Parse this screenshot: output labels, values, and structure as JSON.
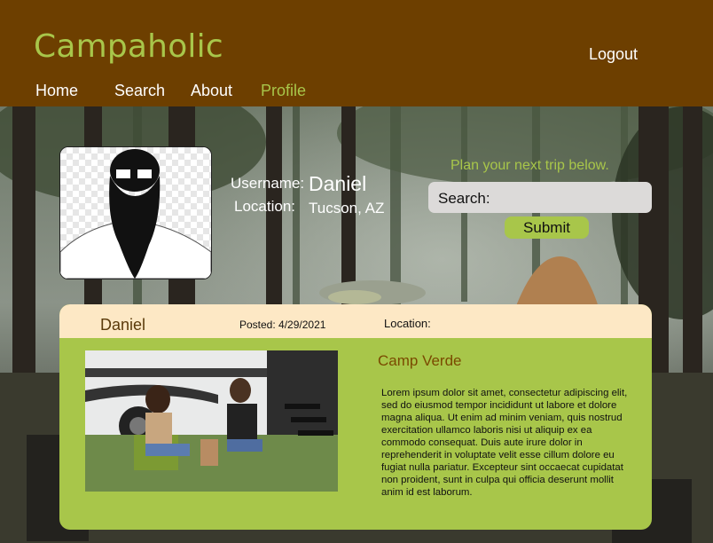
{
  "app": {
    "brand": "Campaholic",
    "logout_label": "Logout"
  },
  "nav": {
    "items": [
      {
        "label": "Home"
      },
      {
        "label": "Search"
      },
      {
        "label": "About"
      },
      {
        "label": "Profile",
        "active": true
      }
    ]
  },
  "profile": {
    "username_label": "Username:",
    "username": "Daniel",
    "location_label": "Location:",
    "location": "Tucson, AZ",
    "avatar_icon": "bearded-man-silhouette"
  },
  "trip_search": {
    "prompt": "Plan your next trip below.",
    "search_label": "Search:",
    "search_value": "",
    "submit_label": "Submit"
  },
  "post": {
    "author": "Daniel",
    "posted": "Posted: 4/29/2021",
    "location_label": "Location:",
    "title": "Camp Verde",
    "body": "Lorem ipsum dolor sit amet, consectetur adipiscing elit, sed do eiusmod tempor incididunt ut labore et dolore magna aliqua. Ut enim ad minim veniam, quis nostrud exercitation ullamco laboris nisi ut aliquip ex ea commodo consequat. Duis aute irure dolor in reprehenderit in voluptate velit esse cillum dolore eu fugiat nulla pariatur. Excepteur sint occaecat cupidatat non proident, sunt in culpa qui officia deserunt mollit anim id est laborum."
  },
  "colors": {
    "header": "#6d3f00",
    "accent": "#a8c64a",
    "card": "#a8c64a",
    "card_header": "#fde8c5"
  }
}
